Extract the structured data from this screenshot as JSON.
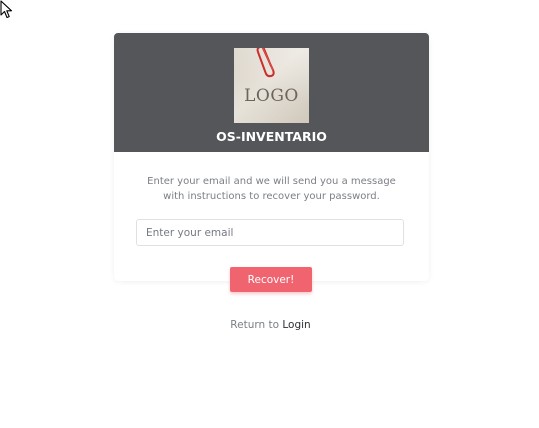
{
  "header": {
    "logo_text": "LOGO",
    "app_title": "OS-INVENTARIO"
  },
  "form": {
    "instructions": "Enter your email and we will send you a message with instructions to recover your password.",
    "email_placeholder": "Enter your email",
    "email_value": "",
    "submit_label": "Recover!"
  },
  "footer": {
    "return_prefix": "Return to",
    "login_link": "Login"
  },
  "colors": {
    "header_bg": "#54565a",
    "button_bg": "#f0646f",
    "page_bg": "#ffffff"
  },
  "icons": {
    "cursor": "mouse-pointer-icon",
    "clip": "paperclip-icon"
  }
}
